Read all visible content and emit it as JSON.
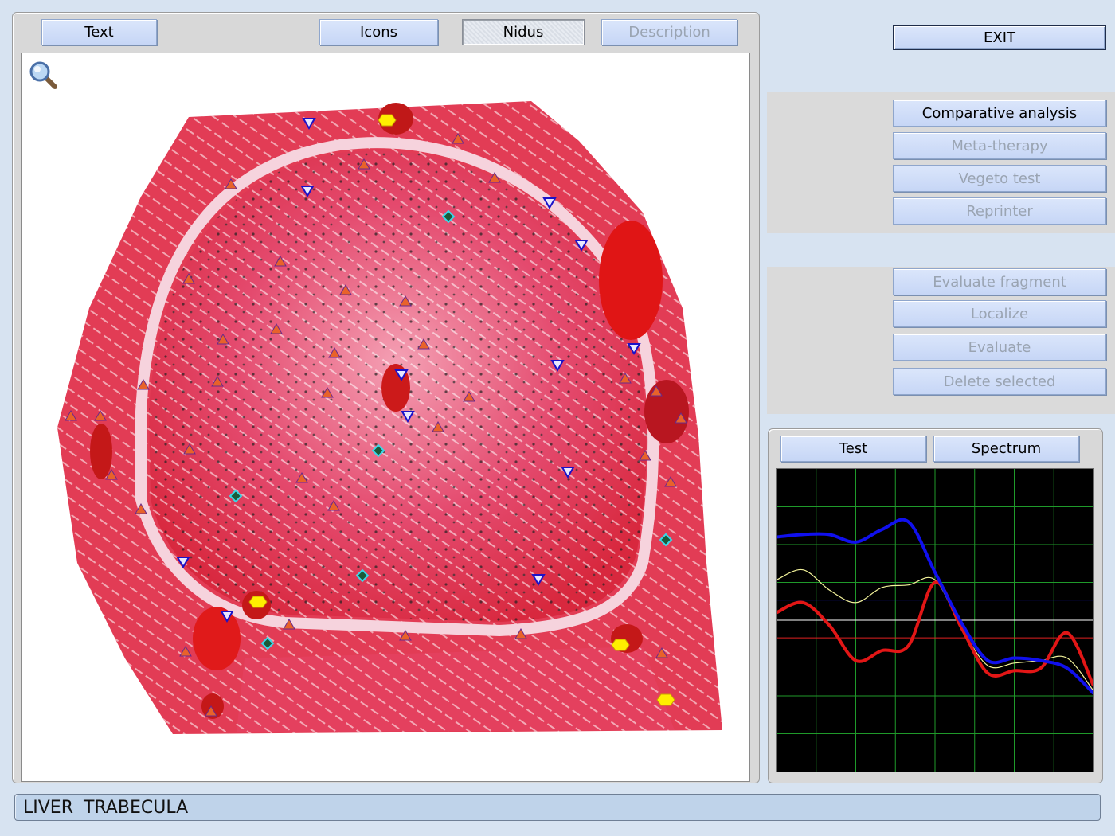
{
  "viewer_panel": {
    "tabs": [
      {
        "label": "Text",
        "state": "normal"
      },
      {
        "label": "Icons",
        "state": "normal"
      },
      {
        "label": "Nidus",
        "state": "selected"
      },
      {
        "label": "Description",
        "state": "disabled"
      }
    ],
    "zoom_icon": "magnifier-icon",
    "marker_icons": [
      "orange-triangle-icon",
      "blue-down-triangle-icon",
      "teal-diamond-icon",
      "yellow-hexagon-icon"
    ]
  },
  "exit_button": {
    "label": "EXIT"
  },
  "analysis_group": {
    "buttons": [
      {
        "label": "Comparative analysis",
        "enabled": true
      },
      {
        "label": "Meta-therapy",
        "enabled": false
      },
      {
        "label": "Vegeto test",
        "enabled": false
      },
      {
        "label": "Reprinter",
        "enabled": false
      }
    ]
  },
  "fragment_group": {
    "buttons": [
      {
        "label": "Evaluate fragment",
        "enabled": false
      },
      {
        "label": "Localize",
        "enabled": false
      },
      {
        "label": "Evaluate",
        "enabled": false
      },
      {
        "label": "Delete selected",
        "enabled": false
      }
    ]
  },
  "graph_panel": {
    "tabs": [
      {
        "label": "Test"
      },
      {
        "label": "Spectrum"
      }
    ],
    "colors": {
      "background": "#000000",
      "grid": "#1f9a2a",
      "blue_curve": "#1010ee",
      "red_curve": "#e21616",
      "yellow_curve": "#f2f29a"
    }
  },
  "chart_data": {
    "type": "line",
    "title": "",
    "xlabel": "",
    "ylabel": "",
    "grid": true,
    "x": [
      0,
      1,
      2,
      3,
      4,
      5,
      6,
      7,
      8,
      9,
      10,
      11,
      12
    ],
    "xlim": [
      0,
      12
    ],
    "ylim": [
      0,
      12
    ],
    "series": [
      {
        "color": "#1010ee",
        "width": "thick",
        "values": [
          9.3,
          9.4,
          9.4,
          9.1,
          9.6,
          9.9,
          7.9,
          5.9,
          4.4,
          4.5,
          4.4,
          4.1,
          3.1
        ]
      },
      {
        "color": "#e21616",
        "width": "thick",
        "values": [
          6.3,
          6.7,
          5.8,
          4.4,
          4.8,
          5.0,
          7.5,
          5.7,
          3.9,
          4.0,
          4.1,
          5.5,
          3.4
        ]
      },
      {
        "color": "#f2f29a",
        "width": "thin",
        "values": [
          7.6,
          8.0,
          7.2,
          6.7,
          7.3,
          7.4,
          7.6,
          5.7,
          4.2,
          4.3,
          4.4,
          4.5,
          3.2
        ]
      }
    ],
    "reference_lines": [
      {
        "color": "#1a1ae0",
        "y": 6.8
      },
      {
        "color": "#ffffff",
        "y": 6.0
      },
      {
        "color": "#e02020",
        "y": 5.3
      }
    ]
  },
  "status_bar": {
    "text": "LIVER  TRABECULA"
  }
}
